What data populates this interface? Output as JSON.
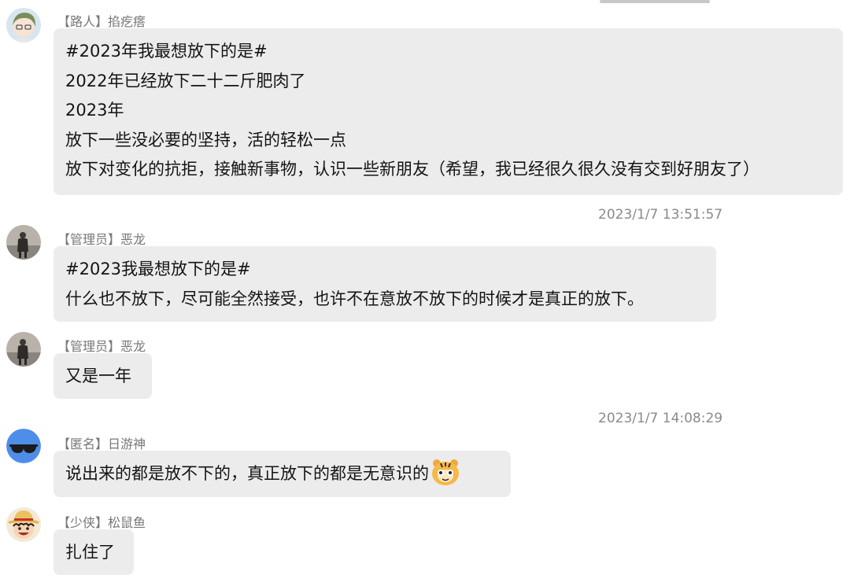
{
  "timestamps": [
    "2023/1/7 13:51:57",
    "2023/1/7 14:08:29"
  ],
  "messages": [
    {
      "sender": "【路人】掐疙瘩",
      "lines": [
        "#2023年我最想放下的是#",
        "2022年已经放下二十二斤肥肉了",
        "2023年",
        "放下一些没必要的坚持，活的轻松一点",
        "放下对变化的抗拒，接触新事物，认识一些新朋友（希望，我已经很久很久没有交到好朋友了）"
      ]
    },
    {
      "sender": "【管理员】恶龙",
      "lines": [
        "#2023我最想放下的是#",
        "什么也不放下，尽可能全然接受，也许不在意放不放下的时候才是真正的放下。"
      ]
    },
    {
      "sender": "【管理员】恶龙",
      "lines": [
        "又是一年"
      ]
    },
    {
      "sender": "【匿名】日游神",
      "lines": [
        "说出来的都是放不下的，真正放下的都是无意识的"
      ],
      "emoji": "tiger-face-emoji"
    },
    {
      "sender": "【少侠】松鼠鱼",
      "lines": [
        "扎住了"
      ]
    }
  ]
}
